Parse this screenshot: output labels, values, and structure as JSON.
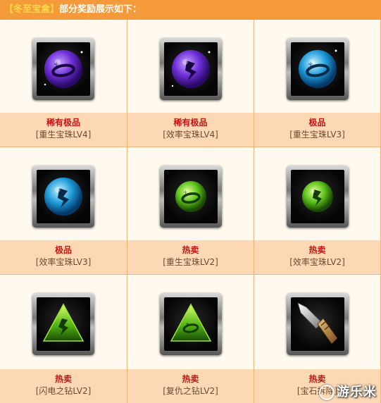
{
  "header": {
    "tag": "【冬至宝盒】",
    "text": "部分奖励展示如下："
  },
  "items": [
    {
      "rarity": "稀有极品",
      "name": "[重生宝珠LV4]",
      "icon": "purple-rebirth-orb-icon"
    },
    {
      "rarity": "稀有极品",
      "name": "[效率宝珠LV4]",
      "icon": "purple-efficiency-orb-icon"
    },
    {
      "rarity": "极品",
      "name": "[重生宝珠LV3]",
      "icon": "blue-rebirth-orb-icon"
    },
    {
      "rarity": "极品",
      "name": "[效率宝珠LV3]",
      "icon": "blue-efficiency-orb-icon"
    },
    {
      "rarity": "热卖",
      "name": "[重生宝珠LV2]",
      "icon": "green-rebirth-orb-icon"
    },
    {
      "rarity": "热卖",
      "name": "[效率宝珠LV2]",
      "icon": "green-efficiency-orb-icon"
    },
    {
      "rarity": "热卖",
      "name": "[闪电之钻LV2]",
      "icon": "lightning-diamond-icon"
    },
    {
      "rarity": "热卖",
      "name": "[复仇之钻LV2]",
      "icon": "revenge-diamond-icon"
    },
    {
      "rarity": "热卖",
      "name": "[宝石拆除]",
      "icon": "gem-removal-tool-icon"
    }
  ],
  "colors": {
    "header_bg": "#f49a3a",
    "rarity_text": "#c81313",
    "label_bg": "#fcd8b4"
  },
  "watermark": {
    "text": "游乐米"
  }
}
